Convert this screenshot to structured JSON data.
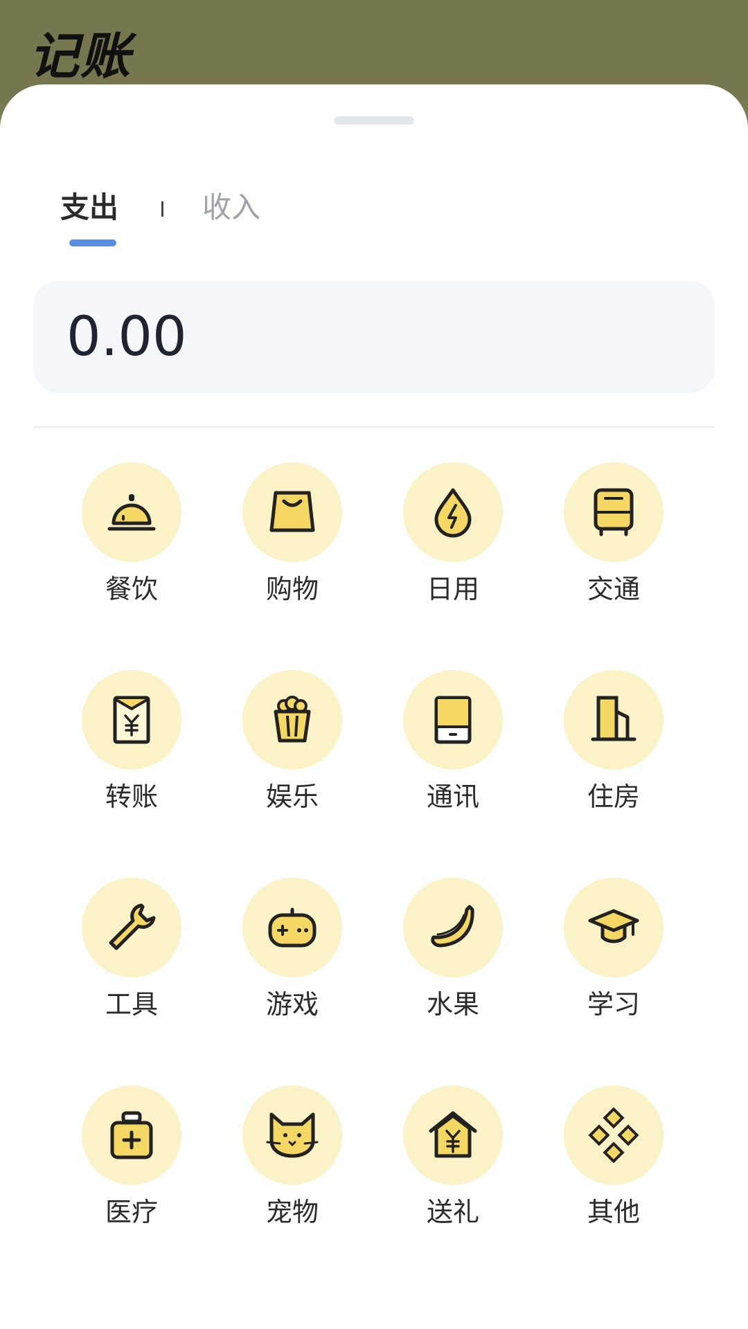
{
  "header": {
    "title": "记账"
  },
  "tabs": {
    "expense": "支出",
    "income": "收入"
  },
  "amount": {
    "value": "0.00"
  },
  "colors": {
    "accent": "#5b8dde",
    "icon_fill": "#f4d863",
    "circle_bg": "#fbf2c8"
  },
  "categories": [
    {
      "label": "餐饮",
      "icon": "dining-bell-icon"
    },
    {
      "label": "购物",
      "icon": "shopping-bag-icon"
    },
    {
      "label": "日用",
      "icon": "utility-drop-icon"
    },
    {
      "label": "交通",
      "icon": "bus-icon"
    },
    {
      "label": "转账",
      "icon": "transfer-envelope-icon"
    },
    {
      "label": "娱乐",
      "icon": "popcorn-icon"
    },
    {
      "label": "通讯",
      "icon": "phone-icon"
    },
    {
      "label": "住房",
      "icon": "building-icon"
    },
    {
      "label": "工具",
      "icon": "wrench-icon"
    },
    {
      "label": "游戏",
      "icon": "gamepad-icon"
    },
    {
      "label": "水果",
      "icon": "banana-icon"
    },
    {
      "label": "学习",
      "icon": "graduation-cap-icon"
    },
    {
      "label": "医疗",
      "icon": "medicine-bottle-icon"
    },
    {
      "label": "宠物",
      "icon": "cat-icon"
    },
    {
      "label": "送礼",
      "icon": "gift-house-icon"
    },
    {
      "label": "其他",
      "icon": "other-diamonds-icon"
    }
  ]
}
